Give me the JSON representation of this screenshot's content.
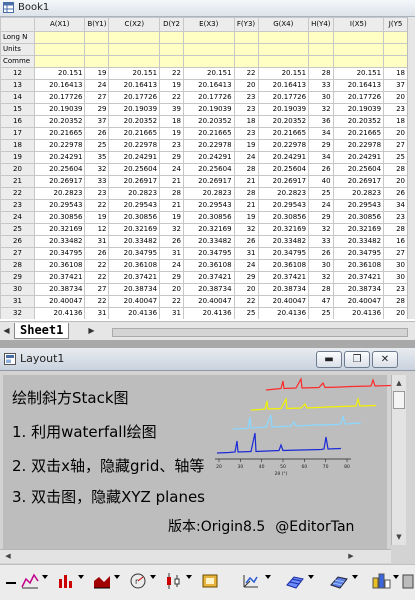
{
  "book": {
    "title": "Book1",
    "columns": [
      "A(X1)",
      "B(Y1)",
      "C(X2)",
      "D(Y2",
      "E(X3)",
      "F(Y3)",
      "G(X4)",
      "H(Y4)",
      "I(X5)",
      "J(Y5"
    ],
    "meta_rows": [
      "Long N",
      "Units",
      "Comme"
    ],
    "rows": [
      [
        "12",
        "20.151",
        "19",
        "20.151",
        "22",
        "20.151",
        "22",
        "20.151",
        "28",
        "20.151",
        "18"
      ],
      [
        "13",
        "20.16413",
        "24",
        "20.16413",
        "19",
        "20.16413",
        "20",
        "20.16413",
        "33",
        "20.16413",
        "37"
      ],
      [
        "14",
        "20.17726",
        "27",
        "20.17726",
        "22",
        "20.17726",
        "23",
        "20.17726",
        "30",
        "20.17726",
        "20"
      ],
      [
        "15",
        "20.19039",
        "29",
        "20.19039",
        "39",
        "20.19039",
        "23",
        "20.19039",
        "32",
        "20.19039",
        "23"
      ],
      [
        "16",
        "20.20352",
        "37",
        "20.20352",
        "18",
        "20.20352",
        "18",
        "20.20352",
        "36",
        "20.20352",
        "18"
      ],
      [
        "17",
        "20.21665",
        "26",
        "20.21665",
        "19",
        "20.21665",
        "23",
        "20.21665",
        "34",
        "20.21665",
        "20"
      ],
      [
        "18",
        "20.22978",
        "25",
        "20.22978",
        "23",
        "20.22978",
        "19",
        "20.22978",
        "29",
        "20.22978",
        "27"
      ],
      [
        "19",
        "20.24291",
        "35",
        "20.24291",
        "29",
        "20.24291",
        "24",
        "20.24291",
        "34",
        "20.24291",
        "25"
      ],
      [
        "20",
        "20.25604",
        "32",
        "20.25604",
        "24",
        "20.25604",
        "28",
        "20.25604",
        "26",
        "20.25604",
        "28"
      ],
      [
        "21",
        "20.26917",
        "33",
        "20.26917",
        "21",
        "20.26917",
        "21",
        "20.26917",
        "40",
        "20.26917",
        "20"
      ],
      [
        "22",
        "20.2823",
        "23",
        "20.2823",
        "28",
        "20.2823",
        "28",
        "20.2823",
        "25",
        "20.2823",
        "26"
      ],
      [
        "23",
        "20.29543",
        "22",
        "20.29543",
        "21",
        "20.29543",
        "21",
        "20.29543",
        "24",
        "20.29543",
        "34"
      ],
      [
        "24",
        "20.30856",
        "19",
        "20.30856",
        "19",
        "20.30856",
        "19",
        "20.30856",
        "29",
        "20.30856",
        "23"
      ],
      [
        "25",
        "20.32169",
        "12",
        "20.32169",
        "32",
        "20.32169",
        "32",
        "20.32169",
        "32",
        "20.32169",
        "28"
      ],
      [
        "26",
        "20.33482",
        "31",
        "20.33482",
        "26",
        "20.33482",
        "26",
        "20.33482",
        "33",
        "20.33482",
        "16"
      ],
      [
        "27",
        "20.34795",
        "26",
        "20.34795",
        "31",
        "20.34795",
        "31",
        "20.34795",
        "26",
        "20.34795",
        "27"
      ],
      [
        "28",
        "20.36108",
        "22",
        "20.36108",
        "24",
        "20.36108",
        "24",
        "20.36108",
        "30",
        "20.36108",
        "30"
      ],
      [
        "29",
        "20.37421",
        "22",
        "20.37421",
        "29",
        "20.37421",
        "29",
        "20.37421",
        "32",
        "20.37421",
        "30"
      ],
      [
        "30",
        "20.38734",
        "27",
        "20.38734",
        "20",
        "20.38734",
        "20",
        "20.38734",
        "28",
        "20.38734",
        "23"
      ],
      [
        "31",
        "20.40047",
        "22",
        "20.40047",
        "22",
        "20.40047",
        "22",
        "20.40047",
        "47",
        "20.40047",
        "28"
      ],
      [
        "32",
        "20.4136",
        "31",
        "20.4136",
        "31",
        "20.4136",
        "25",
        "20.4136",
        "25",
        "20.4136",
        "20"
      ]
    ],
    "sheet_tab": "Sheet1"
  },
  "layout": {
    "title": "Layout1",
    "lines": [
      "绘制斜方Stack图",
      "1. 利用waterfall绘图",
      "2. 双击x轴，隐藏grid、轴等",
      "3. 双击图，隐藏XYZ planes"
    ],
    "credit_version": "版本:Origin8.5",
    "credit_author": "@EditorTan",
    "axis_label": "2θ (°)",
    "axis_ticks": [
      "20",
      "30",
      "40",
      "50",
      "60",
      "70",
      "80"
    ],
    "series_colors": [
      "#ff2a2a",
      "#f2f200",
      "#8ad8ff",
      "#1c2ad6"
    ],
    "window_controls": [
      "minimize",
      "restore",
      "close"
    ]
  },
  "toolbar": {
    "icons": [
      "vector-icon",
      "line-plot-icon",
      "column-plot-icon",
      "area-plot-icon",
      "radial-plot-icon",
      "stock-plot-icon",
      "template-icon",
      "3d-graph-icon",
      "3d-surface-icon",
      "3d-color-map-icon",
      "3d-bar-icon",
      "page-icon"
    ]
  }
}
